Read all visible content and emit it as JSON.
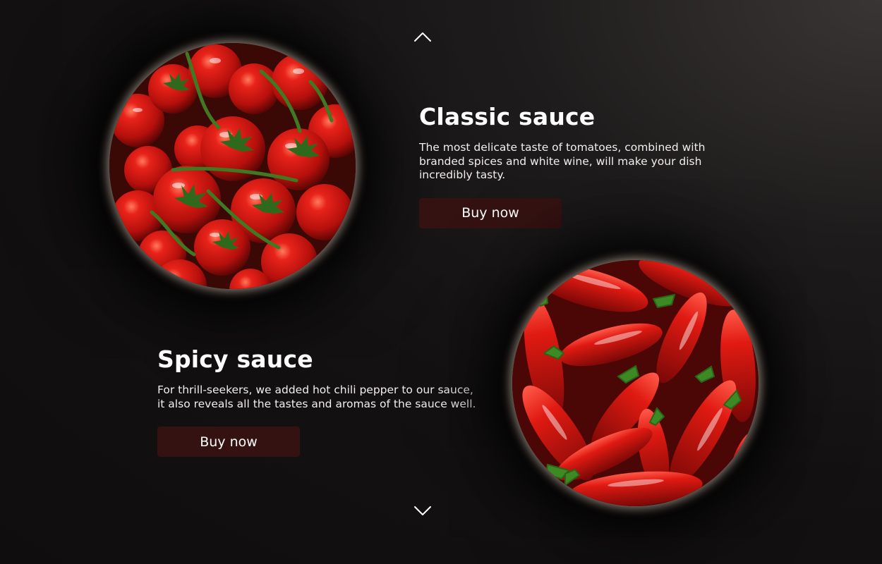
{
  "navigation": {
    "prev_icon": "chevron-up-icon",
    "next_icon": "chevron-down-icon"
  },
  "products": [
    {
      "title": "Classic sauce",
      "description": "The most delicate taste of tomatoes, combined with branded spices and white wine, will make your dish incredibly tasty.",
      "button_label": "Buy now",
      "image_subject": "tomatoes"
    },
    {
      "title": "Spicy sauce",
      "description": "For thrill-seekers, we added hot chili pepper to our sauce, it also reveals all the tastes and aromas of the sauce well.",
      "button_label": "Buy now",
      "image_subject": "red chili peppers"
    }
  ],
  "colors": {
    "background": "#131111",
    "button_bg": "#351212",
    "text": "#ffffff",
    "image_glow": "#ffe6d2"
  }
}
